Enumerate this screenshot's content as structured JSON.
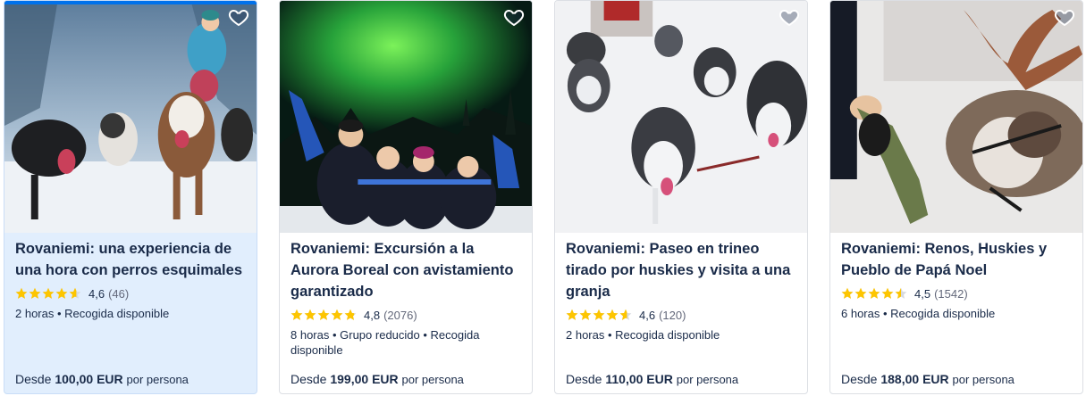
{
  "colors": {
    "star": "#fdc500",
    "text": "#1a2b49",
    "accent": "#0071eb",
    "active_card_bg": "#e1eefd"
  },
  "cards": [
    {
      "title": "Rovaniemi: una experiencia de una hora con perros esquimales",
      "rating": 4.6,
      "rating_text": "4,6",
      "reviews": "(46)",
      "meta": "2 horas • Recogida disponible",
      "price_prefix": "Desde",
      "price": "100,00 EUR",
      "price_unit": "por persona",
      "icon": "heart-icon"
    },
    {
      "title": "Rovaniemi: Excursión a la Aurora Boreal con avistamiento garantizado",
      "rating": 4.8,
      "rating_text": "4,8",
      "reviews": "(2076)",
      "meta": "8 horas • Grupo reducido • Recogida disponible",
      "price_prefix": "Desde",
      "price": "199,00 EUR",
      "price_unit": "por persona",
      "icon": "heart-icon"
    },
    {
      "title": "Rovaniemi: Paseo en trineo tirado por huskies y visita a una granja",
      "rating": 4.6,
      "rating_text": "4,6",
      "reviews": "(120)",
      "meta": "2 horas • Recogida disponible",
      "price_prefix": "Desde",
      "price": "110,00 EUR",
      "price_unit": "por persona",
      "icon": "heart-icon"
    },
    {
      "title": "Rovaniemi: Renos, Huskies y Pueblo de Papá Noel",
      "rating": 4.5,
      "rating_text": "4,5",
      "reviews": "(1542)",
      "meta": "6 horas • Recogida disponible",
      "price_prefix": "Desde",
      "price": "188,00 EUR",
      "price_unit": "por persona",
      "icon": "heart-icon"
    }
  ]
}
